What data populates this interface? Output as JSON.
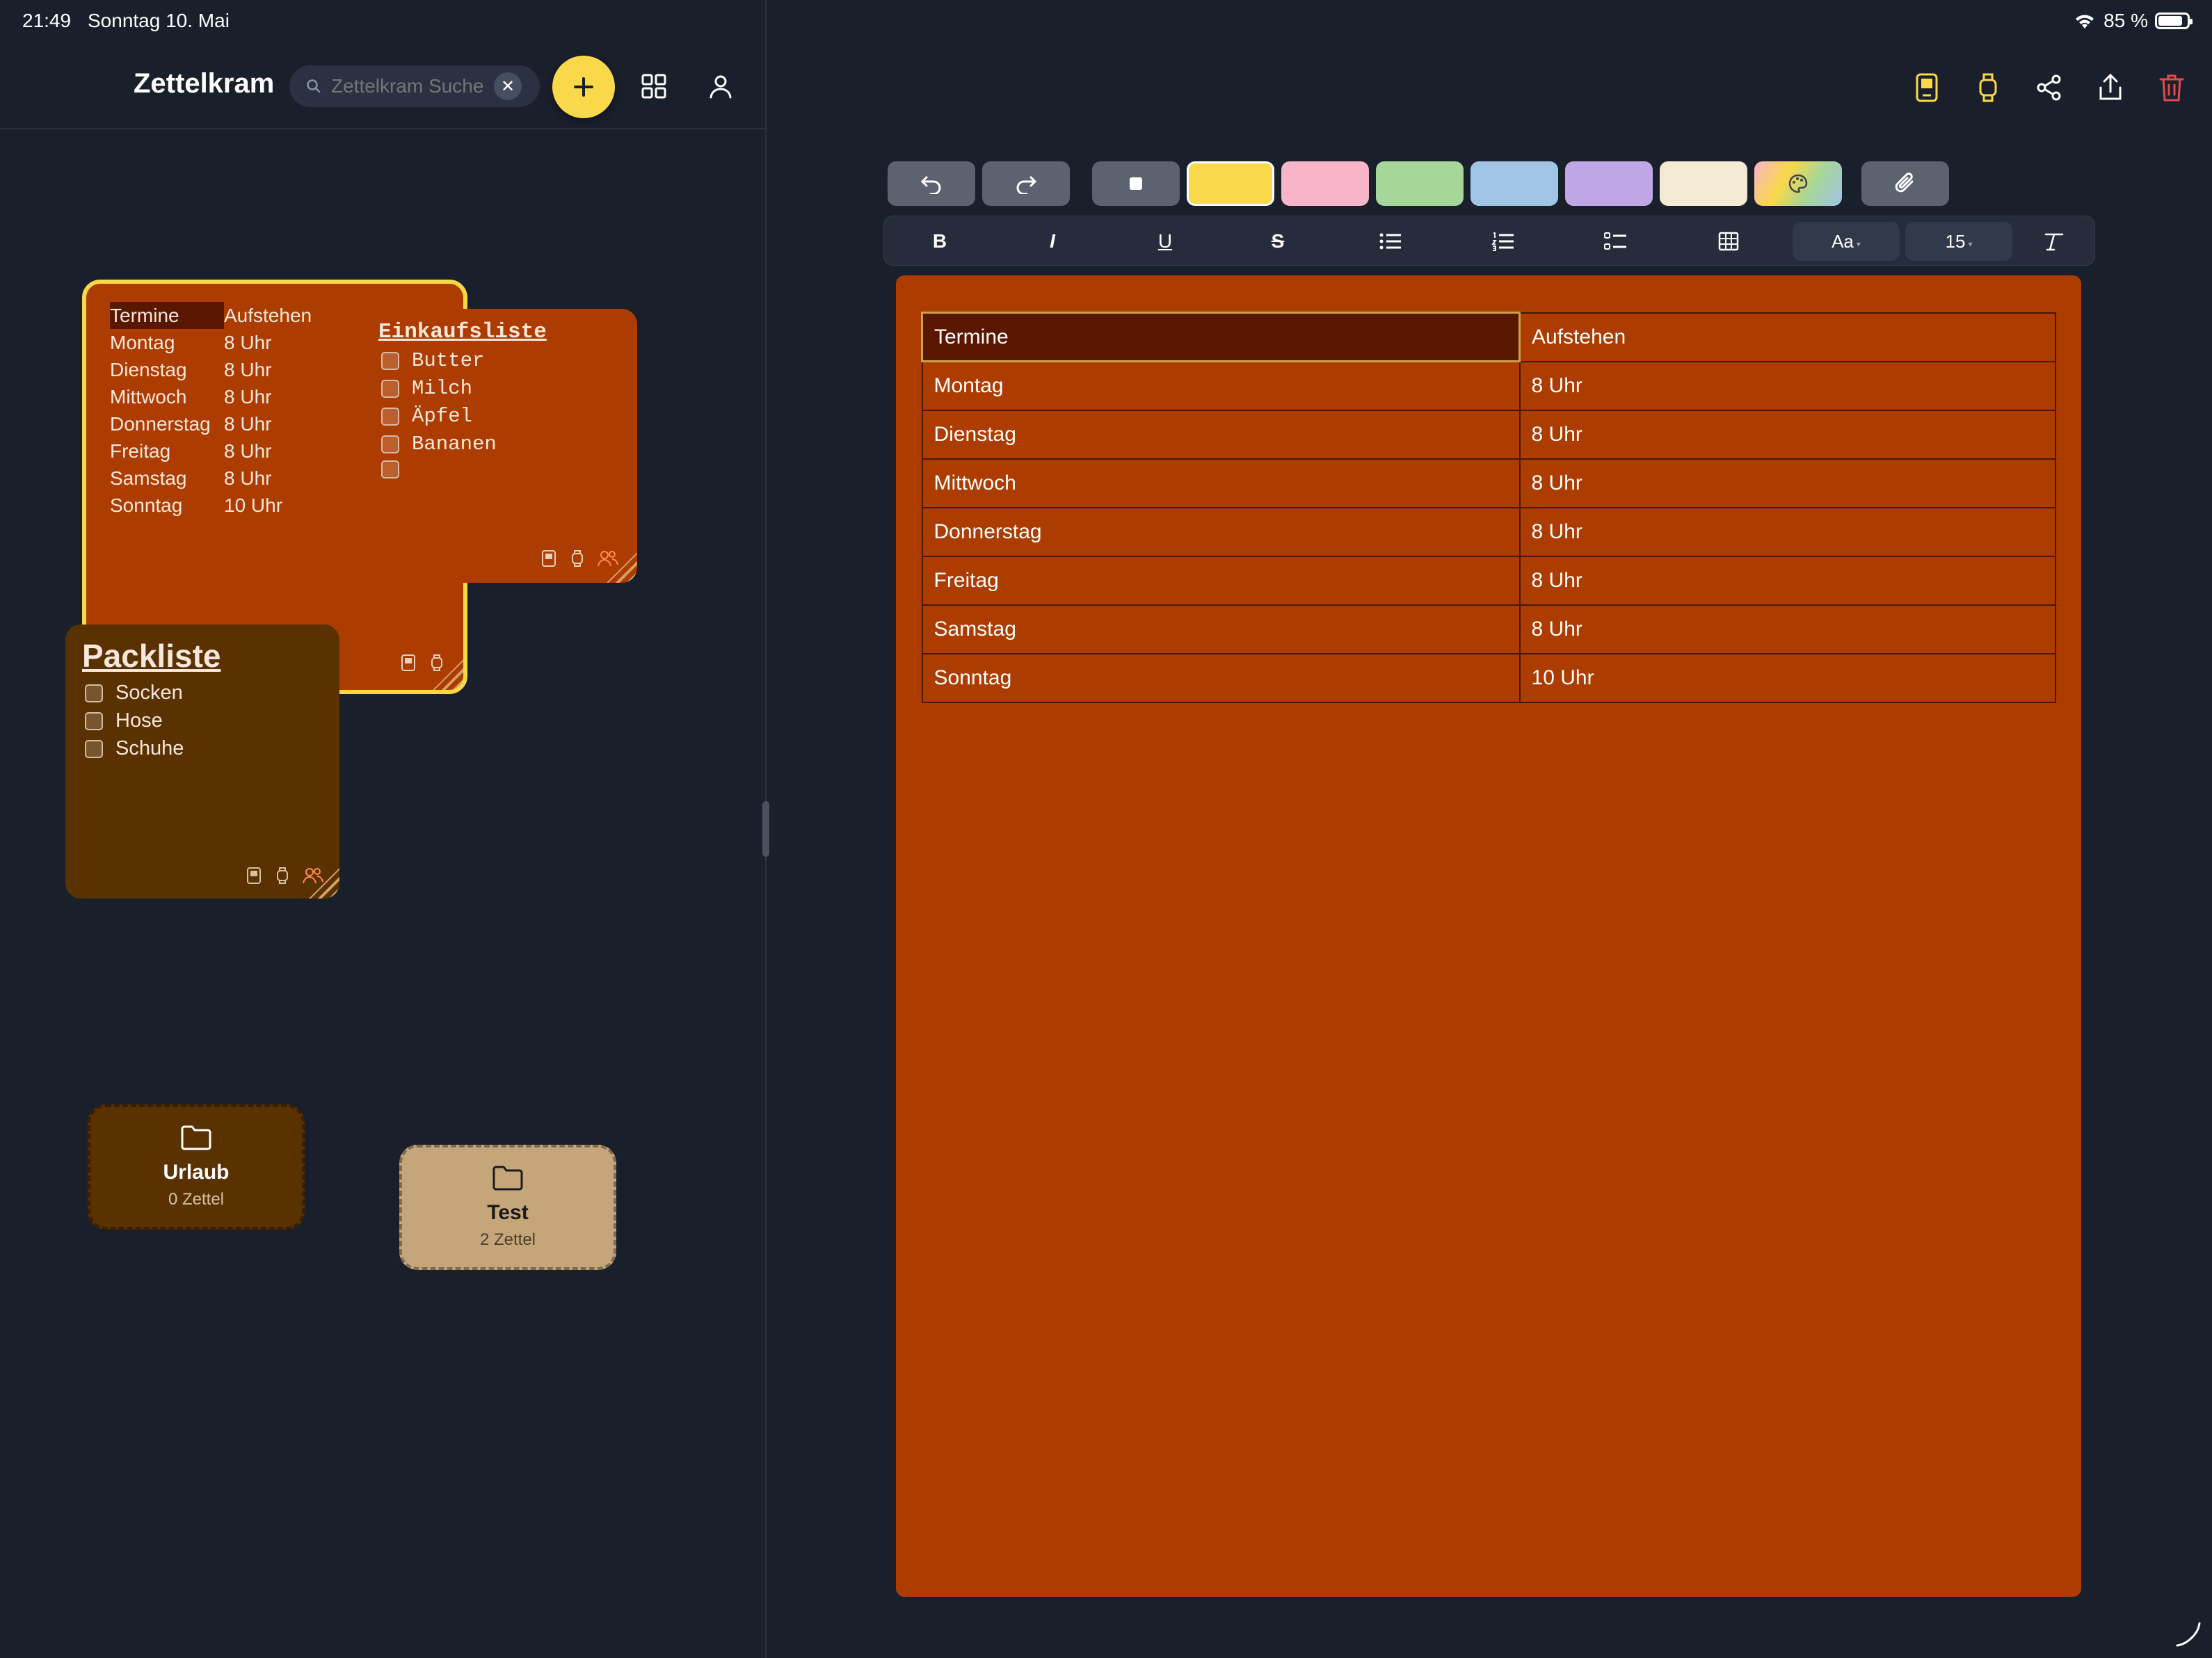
{
  "status": {
    "time": "21:49",
    "date": "Sonntag 10. Mai",
    "battery": "85 %",
    "battery_level": 0.85
  },
  "header": {
    "title": "Zettelkram",
    "search_placeholder": "Zettelkram Suche",
    "search_clear": "✕"
  },
  "notes": {
    "termine": {
      "rows": [
        [
          "Termine",
          "Aufstehen"
        ],
        [
          "Montag",
          "8 Uhr"
        ],
        [
          "Dienstag",
          "8 Uhr"
        ],
        [
          "Mittwoch",
          "8 Uhr"
        ],
        [
          "Donnerstag",
          "8 Uhr"
        ],
        [
          "Freitag",
          "8 Uhr"
        ],
        [
          "Samstag",
          "8 Uhr"
        ],
        [
          "Sonntag",
          "10 Uhr"
        ]
      ]
    },
    "einkauf": {
      "title": "Einkaufsliste",
      "items": [
        "Butter",
        "Milch",
        "Äpfel",
        "Bananen",
        ""
      ]
    },
    "pack": {
      "title": "Packliste",
      "items": [
        "Socken",
        "Hose",
        "Schuhe"
      ]
    }
  },
  "folders": [
    {
      "name": "Urlaub",
      "count": "0 Zettel",
      "color": "#5a3100"
    },
    {
      "name": "Test",
      "count": "2 Zettel",
      "color": "#c5a67a"
    }
  ],
  "editor": {
    "colors": [
      "#5d6270",
      "#f9d84a",
      "#f8b4c8",
      "#a6d69a",
      "#9fc4e4",
      "#bfa6e4",
      "#f3ead4"
    ],
    "format_buttons": {
      "bold": "B",
      "italic": "I",
      "underline": "U",
      "strike": "S"
    },
    "font_button": "Aa",
    "font_size": "15",
    "table": [
      [
        "Termine",
        "Aufstehen"
      ],
      [
        "Montag",
        "8 Uhr"
      ],
      [
        "Dienstag",
        "8 Uhr"
      ],
      [
        "Mittwoch",
        "8 Uhr"
      ],
      [
        "Donnerstag",
        "8 Uhr"
      ],
      [
        "Freitag",
        "8 Uhr"
      ],
      [
        "Samstag",
        "8 Uhr"
      ],
      [
        "Sonntag",
        "10 Uhr"
      ]
    ],
    "background": "#ad3c00"
  },
  "accent": "#f9d84a",
  "delete_color": "#e5484d"
}
